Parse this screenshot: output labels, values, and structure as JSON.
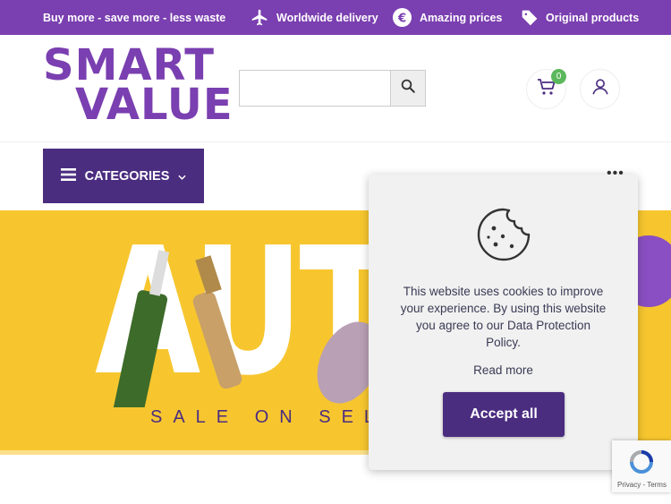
{
  "topbar": {
    "items": [
      {
        "label": "Buy more - save more - less waste",
        "icon": "none"
      },
      {
        "label": "Worldwide delivery",
        "icon": "airplane-icon"
      },
      {
        "label": "Amazing prices",
        "icon": "euro-icon"
      },
      {
        "label": "Original products",
        "icon": "tag-icon"
      }
    ],
    "bg_color": "#7a3fb0"
  },
  "header": {
    "logo": {
      "line1": "SMART",
      "line2": "VALUE",
      "color": "#7a3fb0"
    },
    "search": {
      "placeholder": "",
      "value": "",
      "icon": "search-icon"
    },
    "cart": {
      "icon": "cart-icon",
      "count": "0"
    },
    "account": {
      "icon": "user-icon"
    }
  },
  "nav": {
    "categories_label": "CATEGORIES",
    "more_label": "•••",
    "accent": "#4b2d80"
  },
  "banner": {
    "headline": "AUTU",
    "tagline": "SALE ON SELEC",
    "bg_color": "#f7c62f"
  },
  "cookie": {
    "message": "This website uses cookies to improve your experience. By using this website you agree to our Data Protection Policy.",
    "read_more": "Read more",
    "accept": "Accept all",
    "icon": "cookie-icon"
  },
  "recaptcha": {
    "text": "Privacy - Terms"
  }
}
